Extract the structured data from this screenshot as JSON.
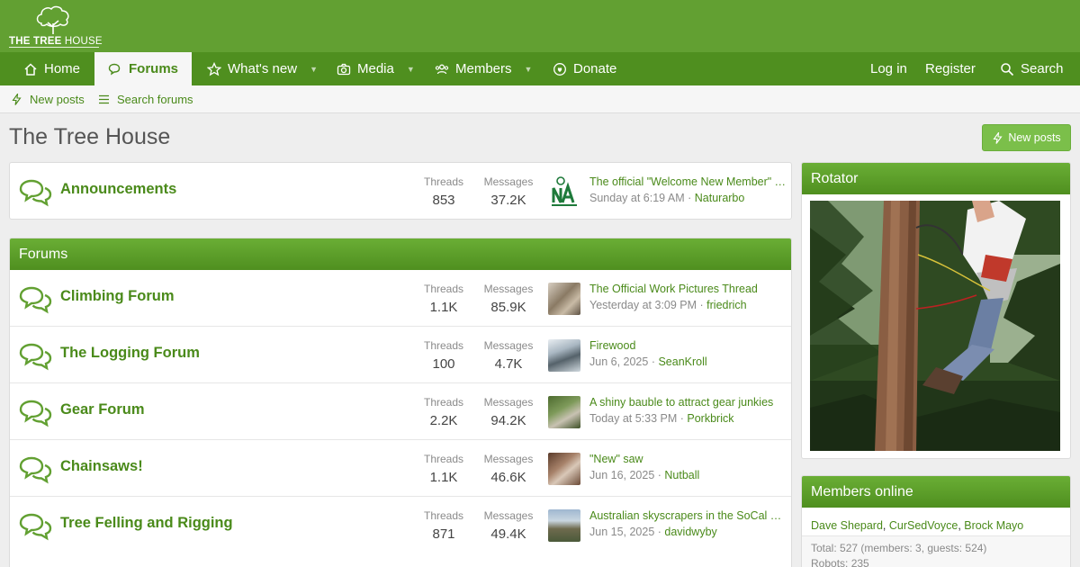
{
  "header": {
    "logo_text_bold": "THE TREE",
    "logo_text_thin": " HOUSE"
  },
  "nav": {
    "items": [
      {
        "label": "Home",
        "icon": "home-icon"
      },
      {
        "label": "Forums",
        "icon": "comments-icon",
        "active": true
      },
      {
        "label": "What's new",
        "icon": "star-icon",
        "has_dropdown": true
      },
      {
        "label": "Media",
        "icon": "camera-icon",
        "has_dropdown": true
      },
      {
        "label": "Members",
        "icon": "users-icon",
        "has_dropdown": true
      },
      {
        "label": "Donate",
        "icon": "donate-icon"
      }
    ],
    "login": "Log in",
    "register": "Register",
    "search": "Search"
  },
  "subnav": {
    "new_posts": "New posts",
    "search_forums": "Search forums"
  },
  "page": {
    "title": "The Tree House",
    "new_posts_button": "New posts"
  },
  "announcements": {
    "title": "Announcements",
    "threads_label": "Threads",
    "threads": "853",
    "messages_label": "Messages",
    "messages": "37.2K",
    "last_title": "The official \"Welcome New Member\" Thread",
    "last_date": "Sunday at 6:19 AM",
    "last_user": "Naturarbo"
  },
  "forums": {
    "heading": "Forums",
    "nodes": [
      {
        "title": "Climbing Forum",
        "threads": "1.1K",
        "messages": "85.9K",
        "last_title": "The Official Work Pictures Thread",
        "last_date": "Yesterday at 3:09 PM",
        "last_user": "friedrich"
      },
      {
        "title": "The Logging Forum",
        "threads": "100",
        "messages": "4.7K",
        "last_title": "Firewood",
        "last_date": "Jun 6, 2025",
        "last_user": "SeanKroll"
      },
      {
        "title": "Gear Forum",
        "threads": "2.2K",
        "messages": "94.2K",
        "last_title": "A shiny bauble to attract gear junkies",
        "last_date": "Today at 5:33 PM",
        "last_user": "Porkbrick"
      },
      {
        "title": "Chainsaws!",
        "threads": "1.1K",
        "messages": "46.6K",
        "last_title": "\"New\" saw",
        "last_date": "Jun 16, 2025",
        "last_user": "Nutball"
      },
      {
        "title": "Tree Felling and Rigging",
        "threads": "871",
        "messages": "49.4K",
        "last_title": "Australian skyscrapers in the SoCal mountains",
        "last_date": "Jun 15, 2025",
        "last_user": "davidwyby"
      }
    ],
    "threads_label": "Threads",
    "messages_label": "Messages"
  },
  "sidebar": {
    "rotator_title": "Rotator",
    "members_online_title": "Members online",
    "online_users": [
      "Dave Shepard",
      "CurSedVoyce",
      "Brock Mayo"
    ],
    "total_line": "Total: 527 (members: 3, guests: 524)",
    "robots_line": "Robots: 235"
  },
  "colors": {
    "header": "#62a032",
    "nav": "#4f8f1f",
    "accent": "#4a8a1a",
    "button": "#7bbf4a"
  }
}
